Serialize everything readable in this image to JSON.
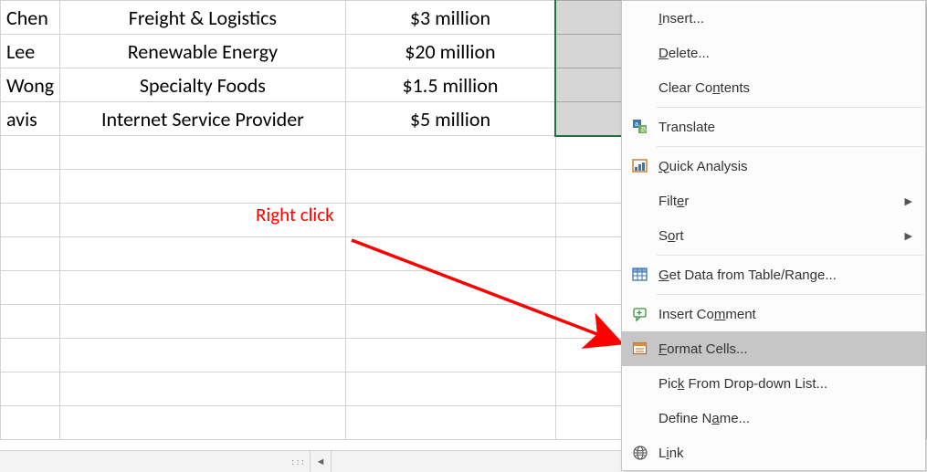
{
  "rows": [
    {
      "name": "Chen",
      "industry": "Freight & Logistics",
      "amount": "$3 million"
    },
    {
      "name": "Lee",
      "industry": "Renewable Energy",
      "amount": "$20 million"
    },
    {
      "name": "Wong",
      "industry": "Specialty Foods",
      "amount": "$1.5 million"
    },
    {
      "name": "avis",
      "industry": "Internet Service Provider",
      "amount": "$5 million"
    }
  ],
  "annotation": {
    "text": "Right click"
  },
  "context_menu": {
    "insert": "Insert...",
    "delete": "Delete...",
    "clear": "Clear Contents",
    "translate": "Translate",
    "quick": "Quick Analysis",
    "filter": "Filter",
    "sort": "Sort",
    "getdata": "Get Data from Table/Range...",
    "comment": "Insert Comment",
    "format": "Format Cells...",
    "pick": "Pick From Drop-down List...",
    "definename": "Define Name...",
    "link": "Link"
  },
  "scrollbar": {
    "dots": ": : :"
  }
}
